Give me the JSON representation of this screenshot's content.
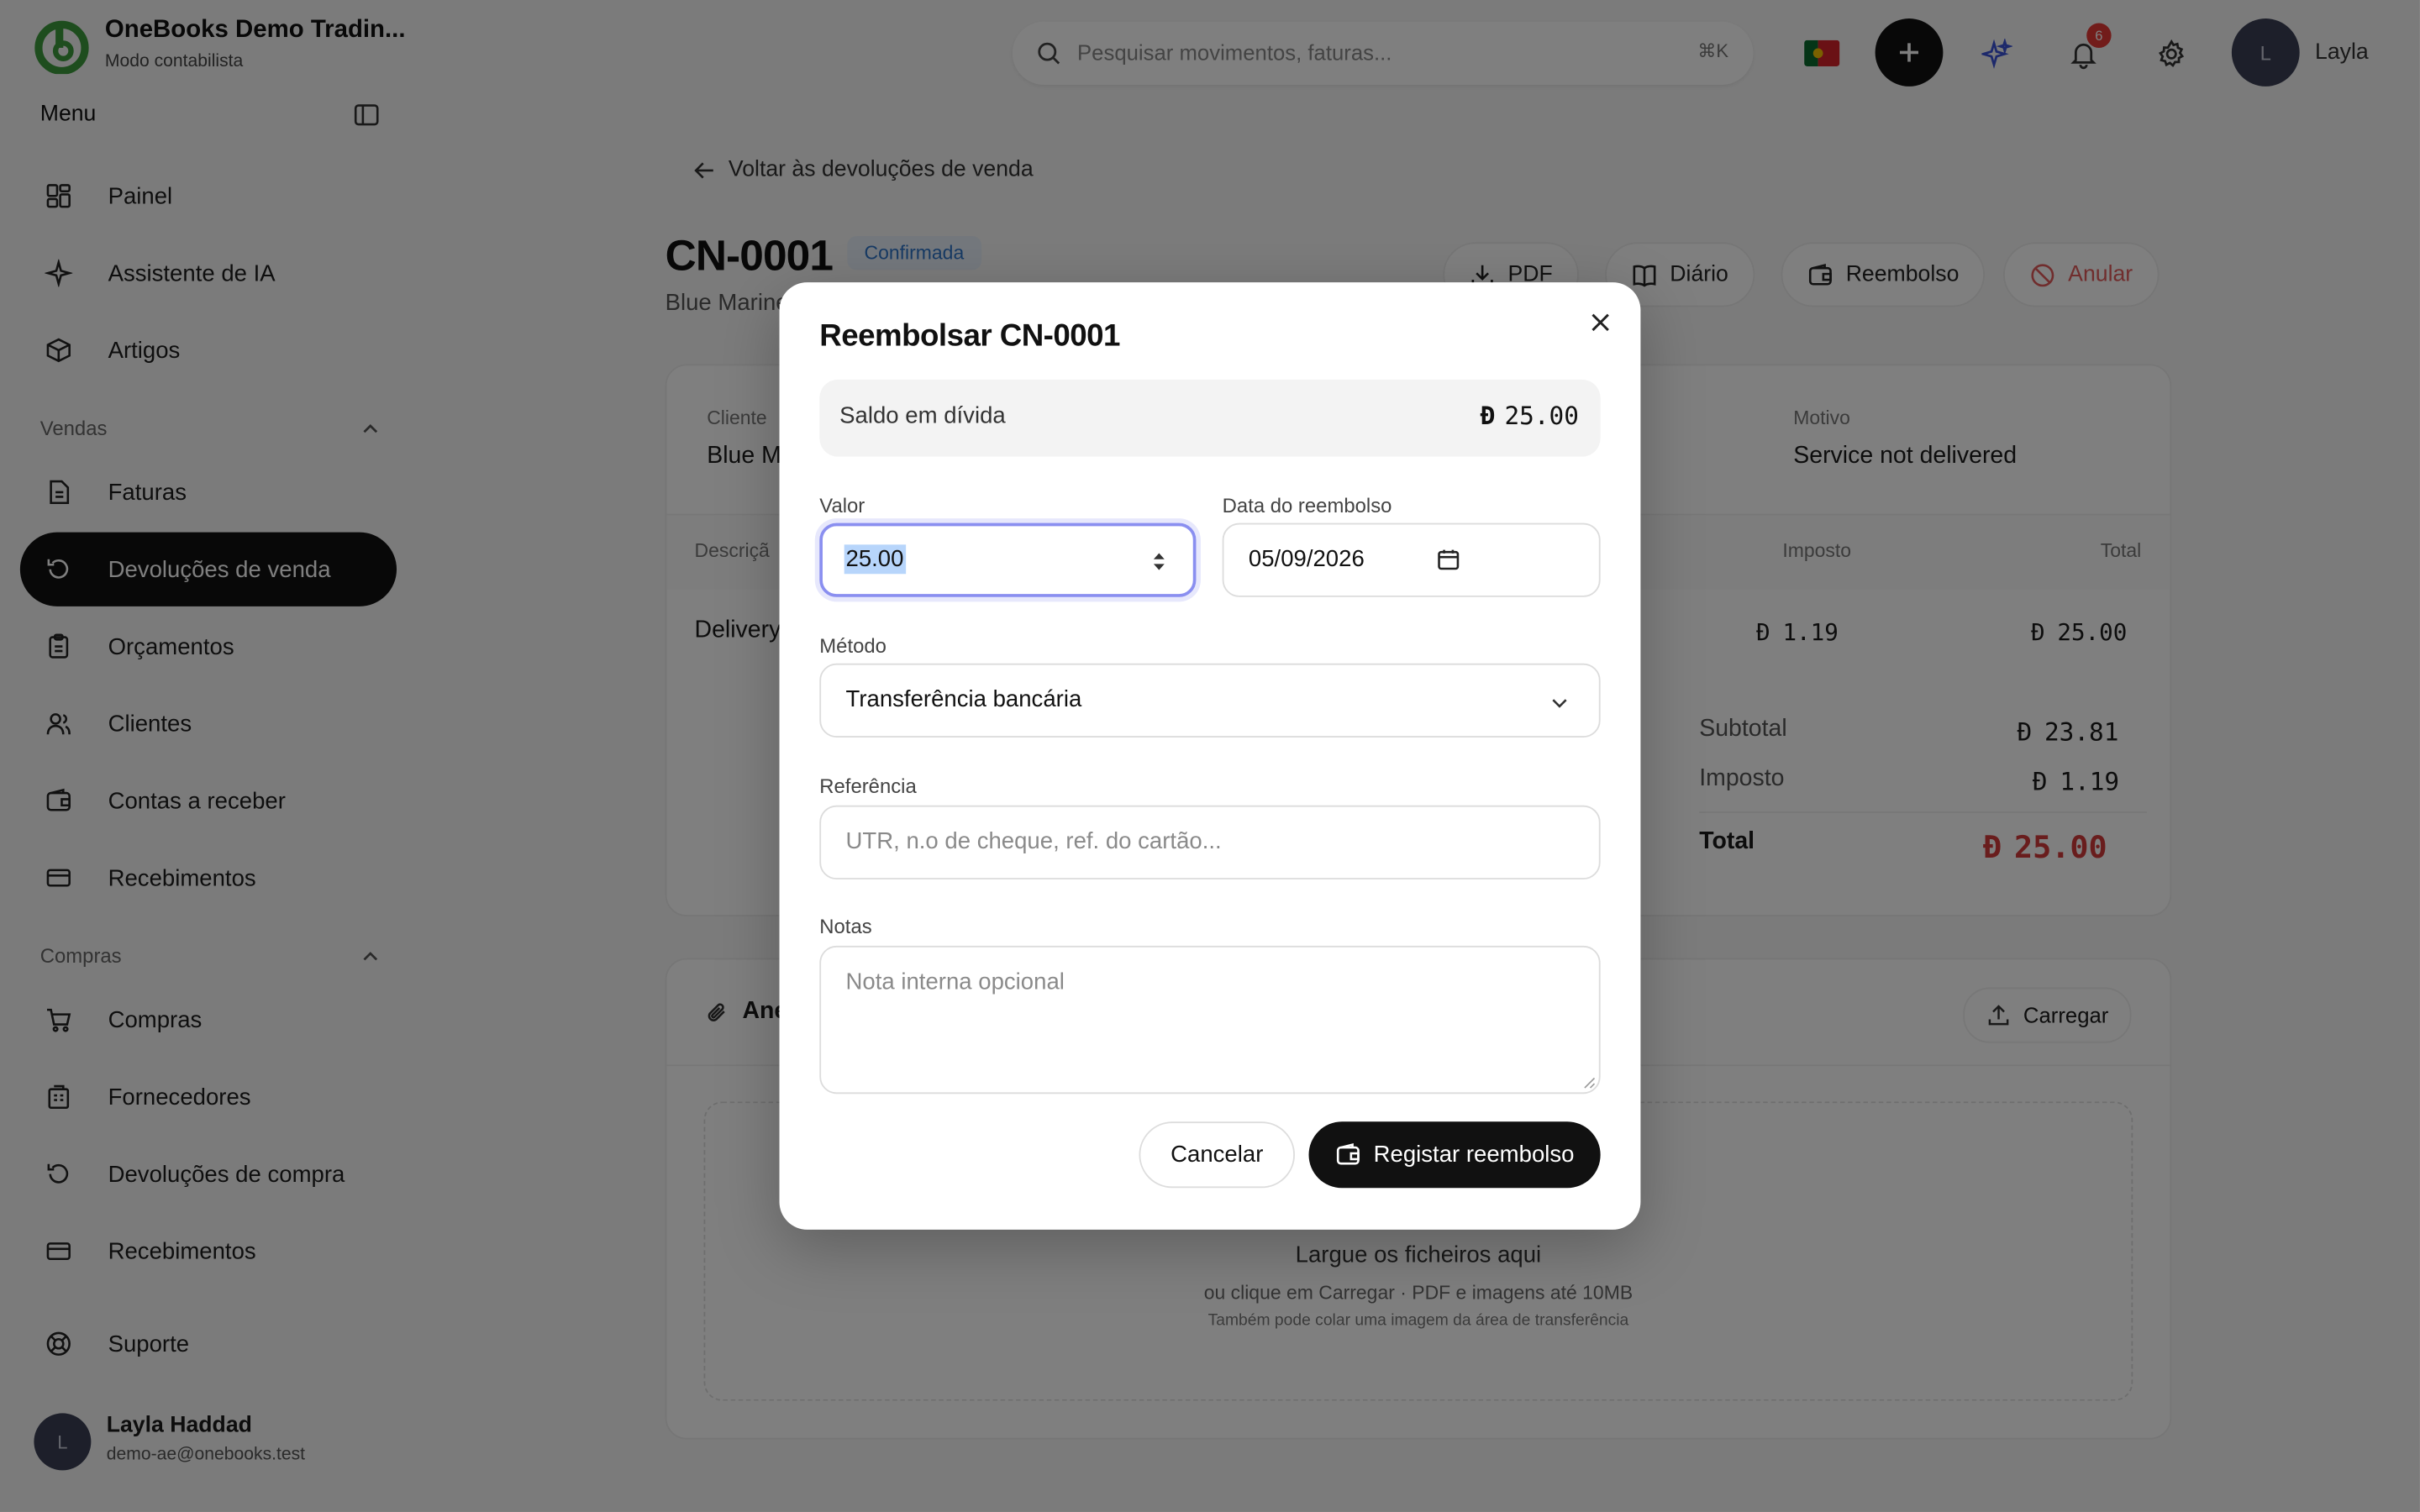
{
  "brand": {
    "name": "OneBooks Demo Tradin...",
    "mode": "Modo contabilista"
  },
  "sidebar": {
    "menu_title": "Menu",
    "top_items": [
      {
        "label": "Painel",
        "icon": "dashboard-icon"
      },
      {
        "label": "Assistente de IA",
        "icon": "sparkles-icon"
      },
      {
        "label": "Artigos",
        "icon": "box-icon"
      }
    ],
    "sales_title": "Vendas",
    "sales_items": [
      {
        "label": "Faturas",
        "icon": "invoice-icon"
      },
      {
        "label": "Devoluções de venda",
        "icon": "return-icon",
        "active": true
      },
      {
        "label": "Orçamentos",
        "icon": "clipboard-icon"
      },
      {
        "label": "Clientes",
        "icon": "users-icon"
      },
      {
        "label": "Contas a receber",
        "icon": "wallet-icon"
      },
      {
        "label": "Recebimentos",
        "icon": "card-icon"
      }
    ],
    "purchases_title": "Compras",
    "purchase_items": [
      {
        "label": "Compras",
        "icon": "cart-icon"
      },
      {
        "label": "Fornecedores",
        "icon": "building-icon"
      },
      {
        "label": "Devoluções de compra",
        "icon": "return-icon"
      },
      {
        "label": "Recebimentos",
        "icon": "card-icon"
      }
    ],
    "support": "Suporte",
    "user": {
      "initial": "L",
      "name": "Layla Haddad",
      "email": "demo-ae@onebooks.test"
    }
  },
  "topbar": {
    "search_placeholder": "Pesquisar movimentos, faturas...",
    "shortcut": "⌘K",
    "notifications_count": "6",
    "avatar_initial": "L",
    "user_name": "Layla"
  },
  "page": {
    "back_link": "Voltar às devoluções de venda",
    "doc_id": "CN-0001",
    "status": "Confirmada",
    "customer_sub": "Blue Marine",
    "actions": {
      "pdf": "PDF",
      "journal": "Diário",
      "refund": "Reembolso",
      "void": "Anular"
    },
    "fields": {
      "customer_label": "Cliente",
      "customer_value": "Blue M",
      "reason_label": "Motivo",
      "reason_value": "Service not delivered"
    },
    "table": {
      "col_desc": "Descriçã",
      "col_tax": "Imposto",
      "col_total": "Total",
      "row_desc": "Delivery",
      "row_tax": "1.19",
      "row_total": "25.00"
    },
    "totals": {
      "subtotal_label": "Subtotal",
      "subtotal": "23.81",
      "tax_label": "Imposto",
      "tax": "1.19",
      "total_label": "Total",
      "total": "25.00"
    },
    "attachments": {
      "title": "Ane",
      "upload": "Carregar",
      "drop_title": "Largue os ficheiros aqui",
      "drop_sub": "ou clique em Carregar · PDF e imagens até 10MB",
      "drop_hint": "Também pode colar uma imagem da área de transferência"
    }
  },
  "modal": {
    "title": "Reembolsar CN-0001",
    "balance_label": "Saldo em dívida",
    "balance_value": "25.00",
    "amount_label": "Valor",
    "amount_value": "25.00",
    "date_label": "Data do reembolso",
    "date_value": "05/09/2026",
    "method_label": "Método",
    "method_value": "Transferência bancária",
    "reference_label": "Referência",
    "reference_placeholder": "UTR, n.o de cheque, ref. do cartão...",
    "notes_label": "Notas",
    "notes_placeholder": "Nota interna opcional",
    "cancel": "Cancelar",
    "submit": "Registar reembolso"
  },
  "colors": {
    "accent": "#111111",
    "status_blue": "#2f75c9",
    "void_red": "#e05a5a",
    "total_red": "#d33a3a"
  },
  "currency_icon": "dirham-icon"
}
